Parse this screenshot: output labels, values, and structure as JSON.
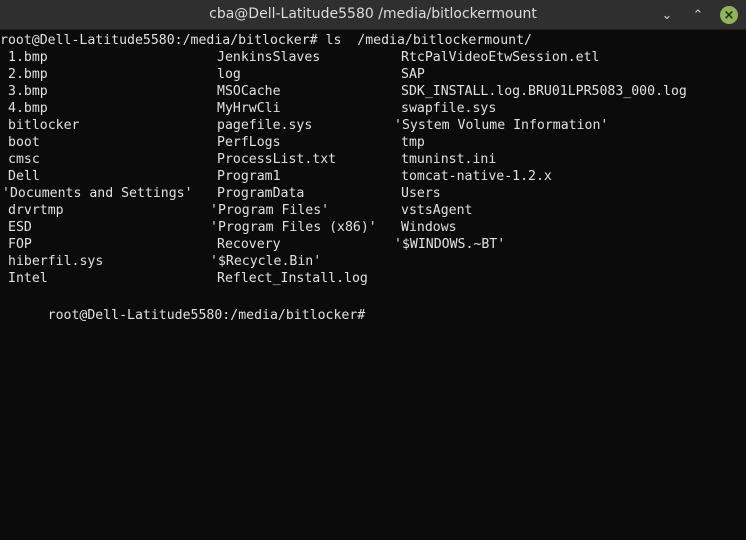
{
  "window": {
    "title": "cba@Dell-Latitude5580 /media/bitlockermount",
    "minimize_glyph": "⌄",
    "maximize_glyph": "⌃",
    "close_glyph": "×"
  },
  "terminal": {
    "command_line": "root@Dell-Latitude5580:/media/bitlocker# ls  /media/bitlockermount/",
    "rows": [
      [
        "1.bmp",
        "JenkinsSlaves",
        "RtcPalVideoEtwSession.etl"
      ],
      [
        "2.bmp",
        "log",
        "SAP"
      ],
      [
        "3.bmp",
        "MSOCache",
        "SDK_INSTALL.log.BRU01LPR5083_000.log"
      ],
      [
        "4.bmp",
        "MyHrwCli",
        "swapfile.sys"
      ],
      [
        "bitlocker",
        "pagefile.sys",
        "'System Volume Information'"
      ],
      [
        "boot",
        "PerfLogs",
        "tmp"
      ],
      [
        "cmsc",
        "ProcessList.txt",
        "tmuninst.ini"
      ],
      [
        "Dell",
        "Program1",
        "tomcat-native-1.2.x"
      ],
      [
        "'Documents and Settings'",
        "ProgramData",
        "Users"
      ],
      [
        "drvrtmp",
        "'Program Files'",
        "vstsAgent"
      ],
      [
        "ESD",
        "'Program Files (x86)'",
        "Windows"
      ],
      [
        "FOP",
        "Recovery",
        "'$WINDOWS.~BT'"
      ],
      [
        "hiberfil.sys",
        "'$Recycle.Bin'",
        ""
      ],
      [
        "Intel",
        "Reflect_Install.log",
        ""
      ]
    ],
    "final_prompt": "root@Dell-Latitude5580:/media/bitlocker#"
  }
}
